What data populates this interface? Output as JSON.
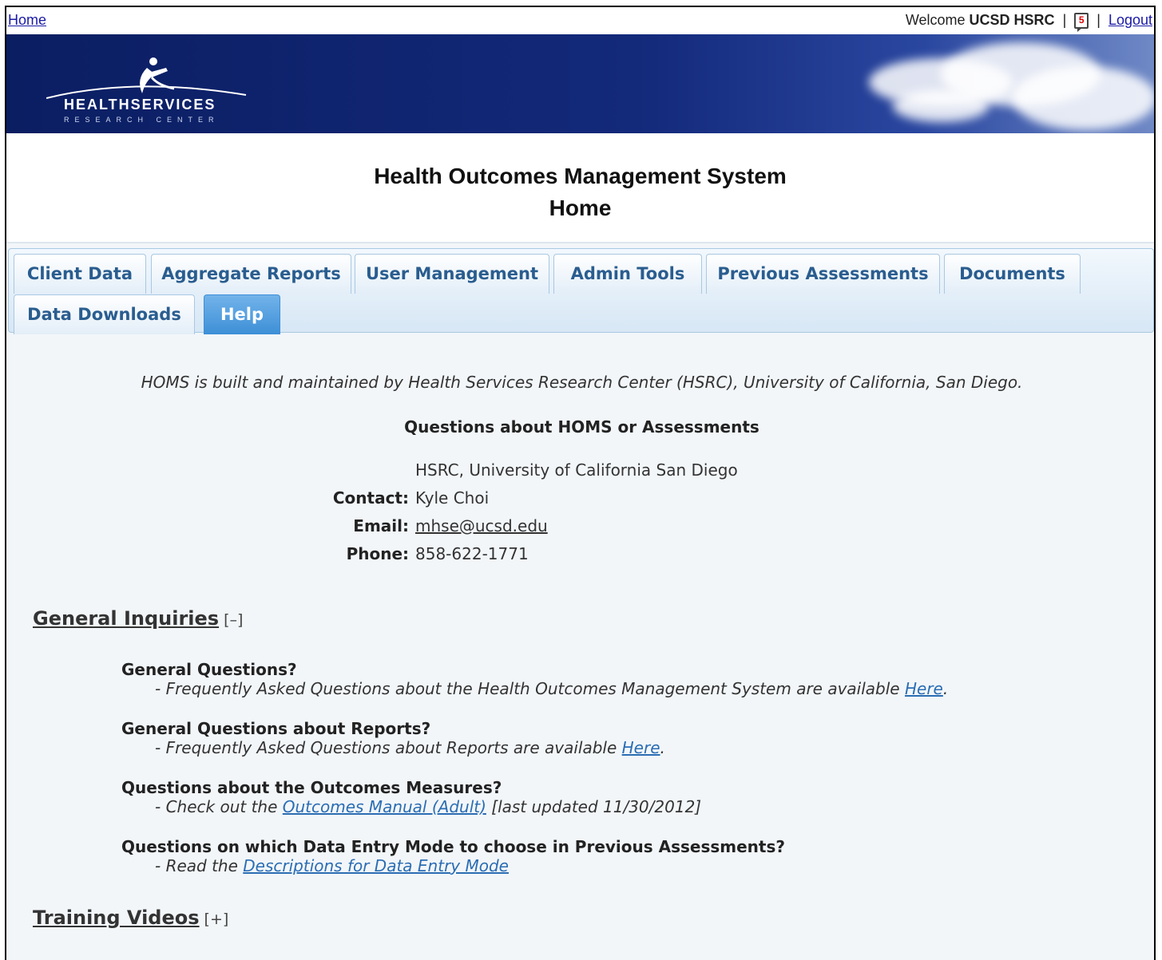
{
  "topbar": {
    "home_label": "Home",
    "welcome_prefix": "Welcome",
    "user_name": "UCSD HSRC",
    "message_count": "5",
    "separator": "|",
    "logout_label": "Logout"
  },
  "banner": {
    "logo_name": "HEALTHSERVICES",
    "logo_sub": "RESEARCH CENTER"
  },
  "page": {
    "title": "Health Outcomes Management System",
    "subtitle": "Home"
  },
  "tabs": [
    {
      "label": "Client Data",
      "active": false
    },
    {
      "label": "Aggregate Reports",
      "active": false
    },
    {
      "label": "User Management",
      "active": false
    },
    {
      "label": "Admin Tools",
      "active": false
    },
    {
      "label": "Previous Assessments",
      "active": false
    },
    {
      "label": "Documents",
      "active": false
    },
    {
      "label": "Data Downloads",
      "active": false
    },
    {
      "label": "Help",
      "active": true
    }
  ],
  "help": {
    "intro": "HOMS is built and maintained by Health Services Research Center (HSRC), University of California, San Diego.",
    "questions_heading": "Questions about HOMS or Assessments",
    "org": "HSRC, University of California San Diego",
    "contact_label": "Contact:",
    "contact_value": "Kyle Choi",
    "email_label": "Email:",
    "email_value": "mhse@ucsd.edu",
    "phone_label": "Phone:",
    "phone_value": "858-622-1771"
  },
  "general_inquiries": {
    "heading": "General Inquiries",
    "toggle": "[–]",
    "items": [
      {
        "question": "General Questions?",
        "answer_prefix": "- Frequently Asked Questions about the Health Outcomes Management System are available ",
        "link": "Here",
        "answer_suffix": "."
      },
      {
        "question": "General Questions about Reports?",
        "answer_prefix": "- Frequently Asked Questions about Reports are available ",
        "link": "Here",
        "answer_suffix": "."
      },
      {
        "question": "Questions about the Outcomes Measures?",
        "answer_prefix": "- Check out the ",
        "link": "Outcomes Manual (Adult)",
        "answer_suffix": " [last updated 11/30/2012]"
      },
      {
        "question": "Questions on which Data Entry Mode to choose in Previous Assessments?",
        "answer_prefix": "- Read the ",
        "link": "Descriptions for Data Entry Mode",
        "answer_suffix": ""
      }
    ]
  },
  "training_videos": {
    "heading": "Training Videos",
    "toggle": "[+]"
  }
}
